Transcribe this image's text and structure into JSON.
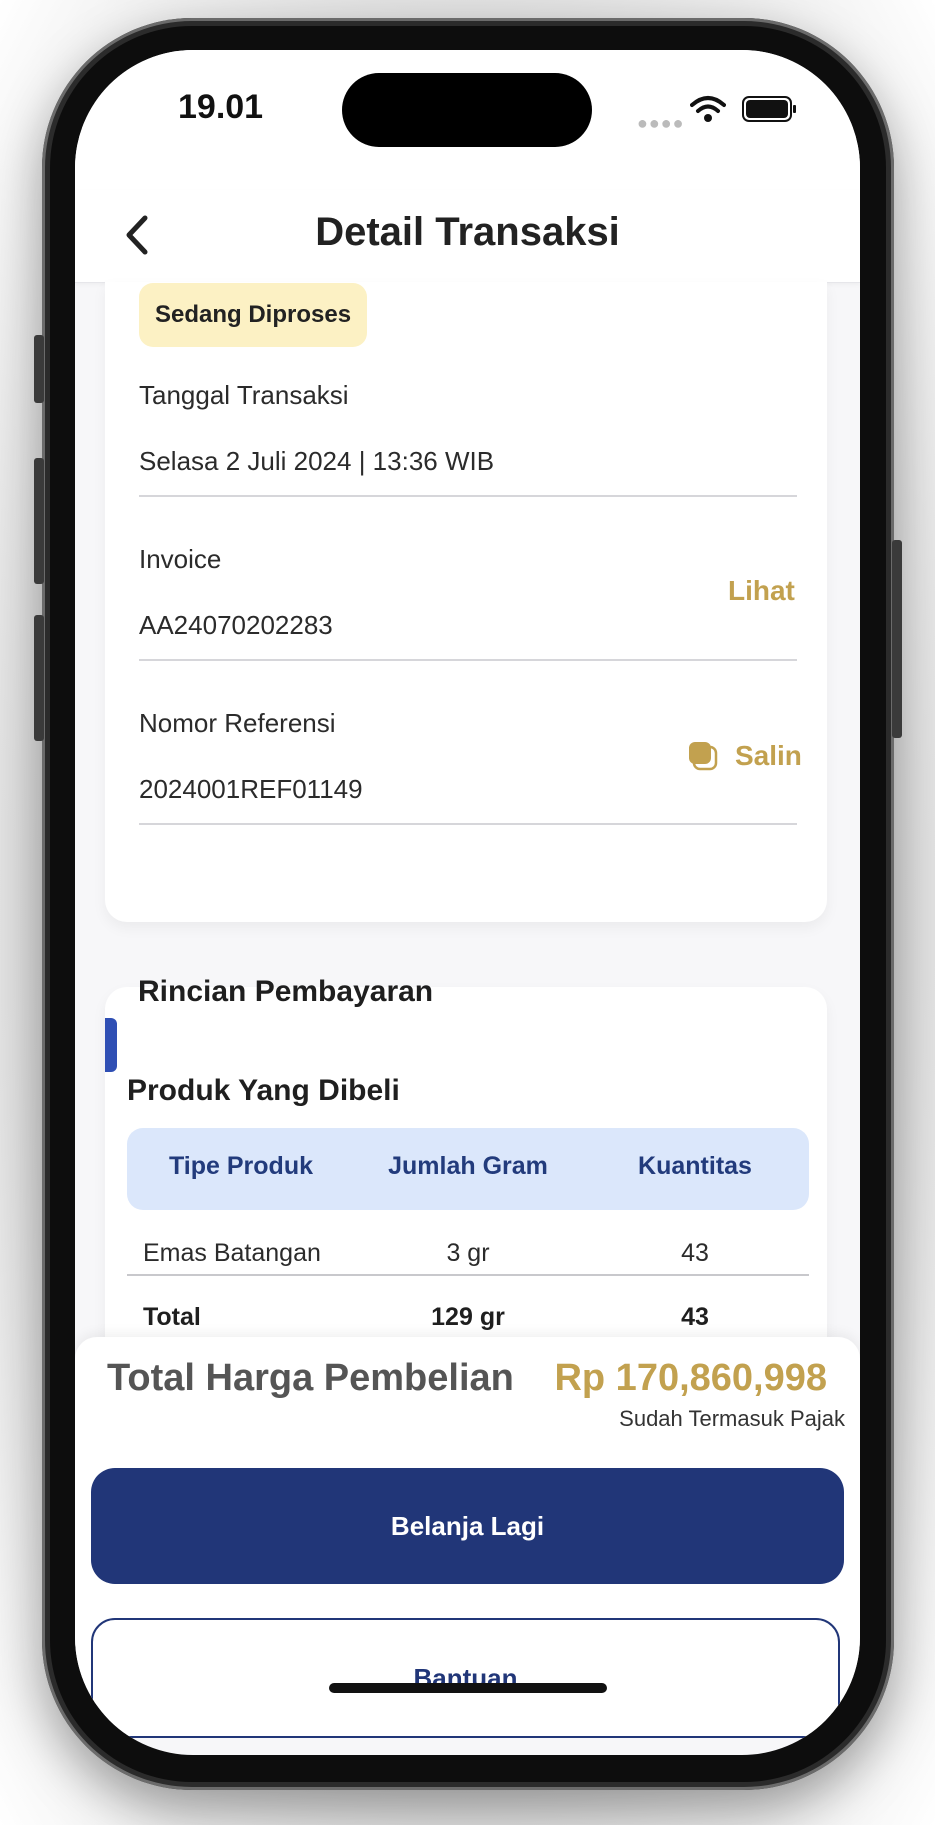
{
  "status_bar": {
    "time": "19.01"
  },
  "header": {
    "title": "Detail Transaksi",
    "back_icon": "chevron-left-icon"
  },
  "transaction": {
    "status_badge": "Sedang Diproses",
    "date_label": "Tanggal Transaksi",
    "date_value": "Selasa 2 Juli 2024 | 13:36 WIB",
    "invoice_label": "Invoice",
    "invoice_value": "AA24070202283",
    "invoice_action": "Lihat",
    "reference_label": "Nomor Referensi",
    "reference_value": "2024001REF01149",
    "reference_action": "Salin"
  },
  "payment": {
    "section_title": "Rincian Pembayaran",
    "products_title": "Produk Yang Dibeli",
    "table": {
      "headers": [
        "Tipe Produk",
        "Jumlah Gram",
        "Kuantitas"
      ],
      "rows": [
        [
          "Emas Batangan",
          "3 gr",
          "43"
        ]
      ],
      "total": [
        "Total",
        "129 gr",
        "43"
      ]
    }
  },
  "summary": {
    "total_label": "Total Harga Pembelian",
    "total_value": "Rp 170,860,998",
    "tax_note": "Sudah Termasuk Pajak"
  },
  "actions": {
    "primary": "Belanja Lagi",
    "secondary": "Bantuan"
  },
  "colors": {
    "accent_gold": "#c2a14f",
    "primary_navy": "#213678",
    "badge_bg": "#fcf1c4"
  }
}
